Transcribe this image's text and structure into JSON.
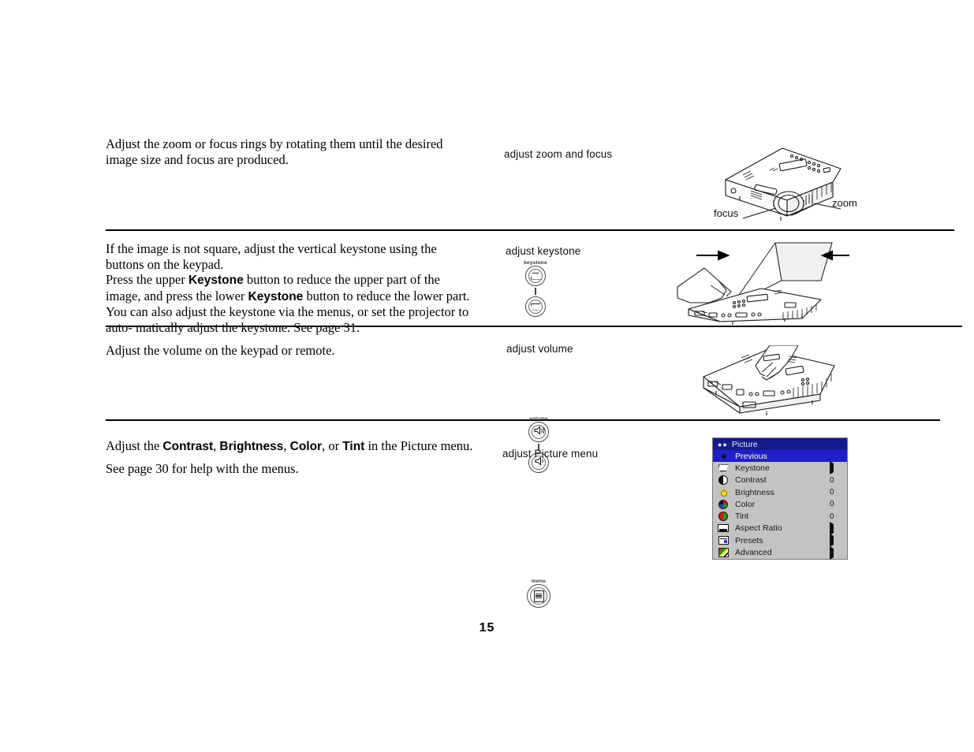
{
  "page": {
    "number": "15"
  },
  "sections": [
    {
      "id": "zoom-focus",
      "caption": "adjust zoom and focus",
      "paragraphs": [
        "Adjust the zoom or focus rings by rotating them until the desired image size and focus are produced."
      ],
      "illustration": {
        "name": "projector-zoom-focus",
        "callouts": [
          "focus",
          "zoom"
        ]
      }
    },
    {
      "id": "keystone",
      "caption": "adjust keystone",
      "keypad_label": "keystone",
      "paragraphs": [
        "If the image is not square, adjust the vertical keystone using the buttons on the keypad.",
        "Press the upper Keystone button to reduce the upper part of the image, and press the lower Keystone button to reduce the lower part.",
        "You can also adjust the keystone via the menus, or set the projector to automatically adjust the keystone. See page 31."
      ],
      "bold_terms": [
        "Keystone"
      ],
      "illustration": {
        "name": "projector-keystone-correction"
      }
    },
    {
      "id": "volume",
      "caption": "adjust volume",
      "keypad_label": "volume",
      "paragraphs": [
        "Adjust the volume on the keypad or remote."
      ],
      "illustration": {
        "name": "projector-volume-keypad"
      }
    },
    {
      "id": "picture-menu",
      "caption": "adjust Picture menu",
      "keypad_label": "menu",
      "paragraphs": [
        "Adjust the Contrast, Brightness, Color, or Tint in the Picture menu.",
        "See page 30 for help with the menus."
      ],
      "bold_terms": [
        "Contrast",
        "Brightness",
        "Color",
        "Tint"
      ]
    }
  ],
  "text": {
    "block1_line1": "Adjust the zoom or focus rings by rotating them until the desired image size",
    "block1_line2": "and focus are produced.",
    "block2_l1": "If the image is not square, adjust the vertical keystone using the buttons on",
    "block2_l2": "the keypad.",
    "block2_l3a": "Press the upper ",
    "block2_l3b": "Keystone",
    "block2_l3c": " button to reduce the upper part of the image, and",
    "block2_l4a": "press the lower ",
    "block2_l4b": "Keystone",
    "block2_l4c": " button to reduce the lower part.",
    "block2_l5": "You can also adjust the keystone via the menus, or set the projector to auto-",
    "block2_l6": "matically adjust the keystone. See page 31.",
    "block3_l1": "Adjust the volume on the keypad or remote.",
    "block4_a": "Adjust the ",
    "block4_b": "Contrast",
    "block4_c": ", ",
    "block4_d": "Brightness",
    "block4_e": ", ",
    "block4_f": "Color",
    "block4_g": ", or ",
    "block4_h": "Tint",
    "block4_i": " in the Picture menu.",
    "block4_l2": "See page 30 for help with the menus."
  },
  "captions": {
    "zoom_focus": "adjust zoom and focus",
    "keystone": "adjust keystone",
    "volume": "adjust volume",
    "picture_menu": "adjust Picture menu"
  },
  "keypad": {
    "keystone_label": "keystone",
    "volume_label": "volume",
    "menu_label": "menu"
  },
  "illustration_callouts": {
    "focus": "focus",
    "zoom": "zoom"
  },
  "osd_menu": {
    "title": "Picture",
    "title_dots": "●●",
    "colors": {
      "titlebar": "#151b8d",
      "selected": "#2020c8",
      "background": "#c3c3c3",
      "border": "#7a7a7a"
    },
    "rows": [
      {
        "label": "Previous",
        "icon": "back-arrow-icon",
        "value": "",
        "selected": true,
        "submenu": false
      },
      {
        "label": "Keystone",
        "icon": "keystone-icon",
        "value": "",
        "selected": false,
        "submenu": true
      },
      {
        "label": "Contrast",
        "icon": "contrast-icon",
        "value": "0",
        "selected": false,
        "submenu": false
      },
      {
        "label": "Brightness",
        "icon": "brightness-icon",
        "value": "0",
        "selected": false,
        "submenu": false
      },
      {
        "label": "Color",
        "icon": "color-icon",
        "value": "0",
        "selected": false,
        "submenu": false
      },
      {
        "label": "Tint",
        "icon": "tint-icon",
        "value": "0",
        "selected": false,
        "submenu": false
      },
      {
        "label": "Aspect Ratio",
        "icon": "aspect-ratio-icon",
        "value": "",
        "selected": false,
        "submenu": true
      },
      {
        "label": "Presets",
        "icon": "presets-icon",
        "value": "",
        "selected": false,
        "submenu": true
      },
      {
        "label": "Advanced",
        "icon": "advanced-icon",
        "value": "",
        "selected": false,
        "submenu": true
      }
    ]
  }
}
